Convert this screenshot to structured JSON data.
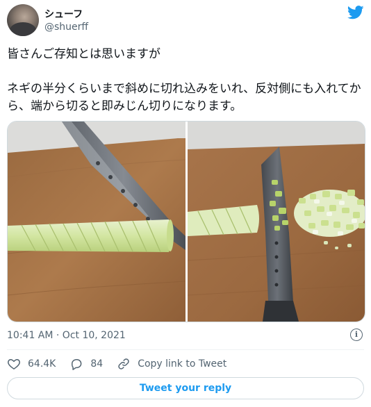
{
  "user": {
    "display_name": "シューフ",
    "handle": "@shuerff"
  },
  "tweet": {
    "line1": "皆さんご存知とは思いますが",
    "line2": "ネギの半分くらいまで斜めに切れ込みをいれ、反対側にも入れてから、端から切ると即みじん切りになります。"
  },
  "media": {
    "photo_left": "cutting-board-knife-scored-leek",
    "photo_right": "cutting-board-knife-minced-leek"
  },
  "meta": {
    "timestamp": "10:41 AM · Oct 10, 2021"
  },
  "actions": {
    "likes": "64.4K",
    "replies": "84",
    "copy_link": "Copy link to Tweet"
  },
  "reply_button": "Tweet your reply",
  "colors": {
    "accent": "#1d9bf0",
    "text": "#0f1419",
    "muted": "#536471",
    "border": "#cfd9de"
  },
  "icons": [
    "twitter-bird-icon",
    "heart-icon",
    "reply-bubble-icon",
    "link-icon",
    "info-icon"
  ]
}
